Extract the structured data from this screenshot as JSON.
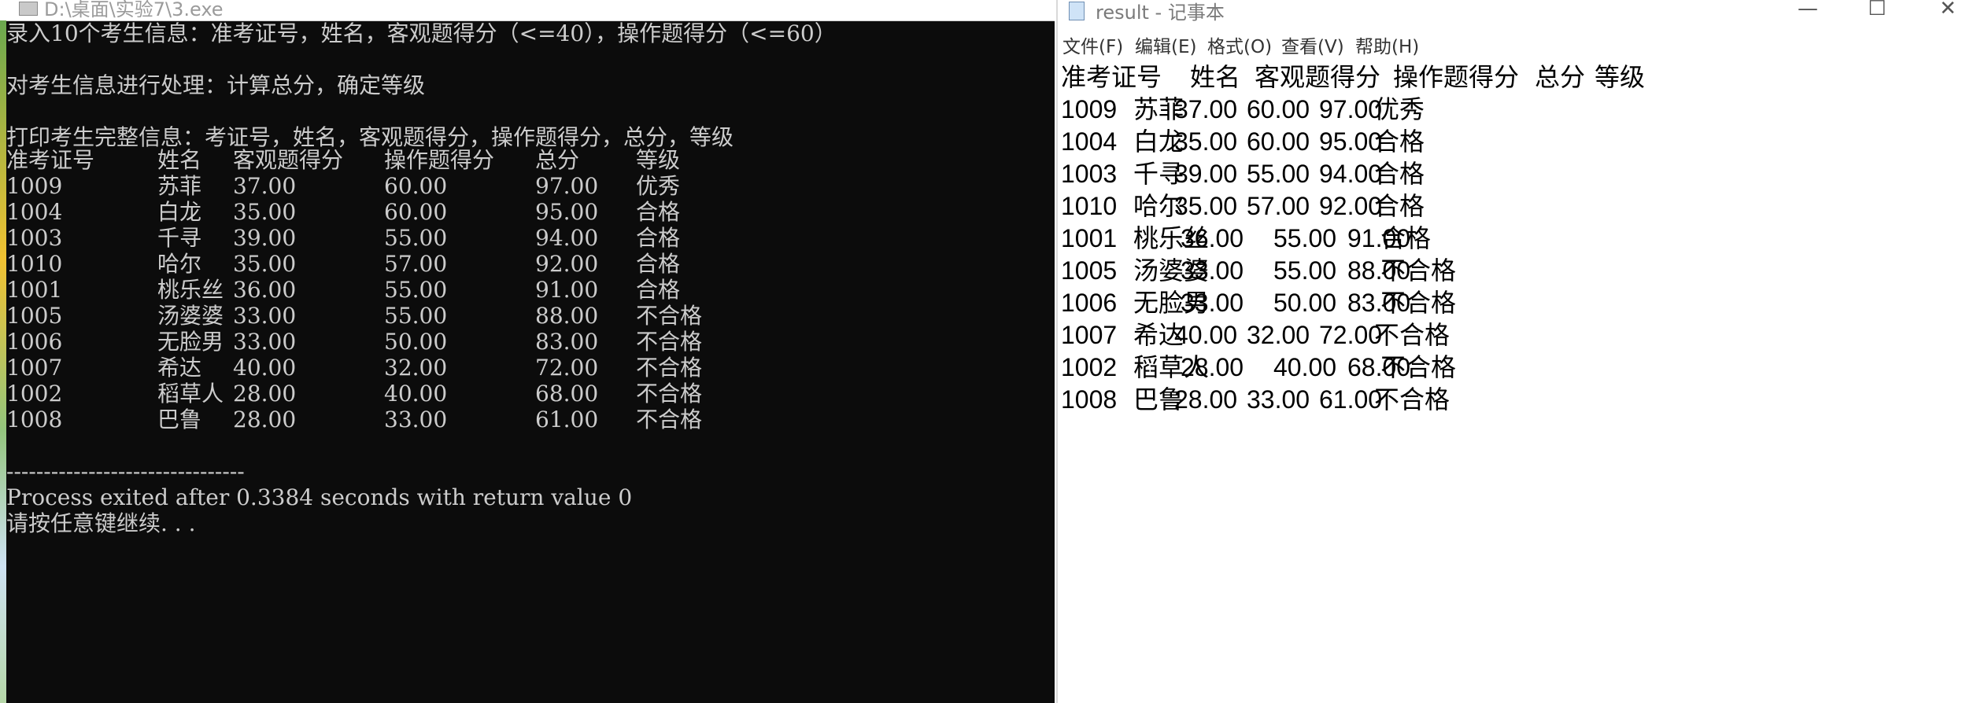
{
  "console": {
    "title": "D:\\桌面\\实验7\\3.exe",
    "lines": [
      "录入10个考生信息：准考证号，姓名，客观题得分（<=40），操作题得分（<=60）",
      "",
      "对考生信息进行处理：计算总分，确定等级",
      "",
      "打印考生完整信息：考证号，姓名，客观题得分，操作题得分，总分，等级"
    ],
    "table_header": [
      "准考证号",
      "姓名",
      "客观题得分",
      "操作题得分",
      "总分",
      "等级"
    ],
    "rows": [
      [
        "1009",
        "苏菲",
        "37.00",
        "60.00",
        "97.00",
        "优秀"
      ],
      [
        "1004",
        "白龙",
        "35.00",
        "60.00",
        "95.00",
        "合格"
      ],
      [
        "1003",
        "千寻",
        "39.00",
        "55.00",
        "94.00",
        "合格"
      ],
      [
        "1010",
        "哈尔",
        "35.00",
        "57.00",
        "92.00",
        "合格"
      ],
      [
        "1001",
        "桃乐丝",
        "36.00",
        "55.00",
        "91.00",
        "合格"
      ],
      [
        "1005",
        "汤婆婆",
        "33.00",
        "55.00",
        "88.00",
        "不合格"
      ],
      [
        "1006",
        "无脸男",
        "33.00",
        "50.00",
        "83.00",
        "不合格"
      ],
      [
        "1007",
        "希达",
        "40.00",
        "32.00",
        "72.00",
        "不合格"
      ],
      [
        "1002",
        "稻草人",
        "28.00",
        "40.00",
        "68.00",
        "不合格"
      ],
      [
        "1008",
        "巴鲁",
        "28.00",
        "33.00",
        "61.00",
        "不合格"
      ]
    ],
    "separator": "--------------------------------",
    "process_exit": "Process exited after 0.3384 seconds with return value 0",
    "press_any_key": "请按任意键继续. . ."
  },
  "notepad": {
    "title": "result - 记事本",
    "window_buttons": {
      "minimize": "—",
      "maximize": "☐",
      "close": "✕"
    },
    "menu": [
      "文件(F)",
      "编辑(E)",
      "格式(O)",
      "查看(V)",
      "帮助(H)"
    ],
    "header": [
      "准考证号",
      "姓名",
      "客观题得分",
      "操作题得分",
      "总分",
      "等级"
    ],
    "rows": [
      [
        "1009",
        "苏菲",
        "37.00",
        "60.00",
        "97.00",
        "优秀"
      ],
      [
        "1004",
        "白龙",
        "35.00",
        "60.00",
        "95.00",
        "合格"
      ],
      [
        "1003",
        "千寻",
        "39.00",
        "55.00",
        "94.00",
        "合格"
      ],
      [
        "1010",
        "哈尔",
        "35.00",
        "57.00",
        "92.00",
        "合格"
      ],
      [
        "1001",
        "桃乐丝",
        "36.00",
        "55.00",
        "91.00",
        "合格"
      ],
      [
        "1005",
        "汤婆婆",
        "33.00",
        "55.00",
        "88.00",
        "不合格"
      ],
      [
        "1006",
        "无脸男",
        "33.00",
        "50.00",
        "83.00",
        "不合格"
      ],
      [
        "1007",
        "希达",
        "40.00",
        "32.00",
        "72.00",
        "不合格"
      ],
      [
        "1002",
        "稻草人",
        "28.00",
        "40.00",
        "68.00",
        "不合格"
      ],
      [
        "1008",
        "巴鲁",
        "28.00",
        "33.00",
        "61.00",
        "不合格"
      ]
    ]
  }
}
